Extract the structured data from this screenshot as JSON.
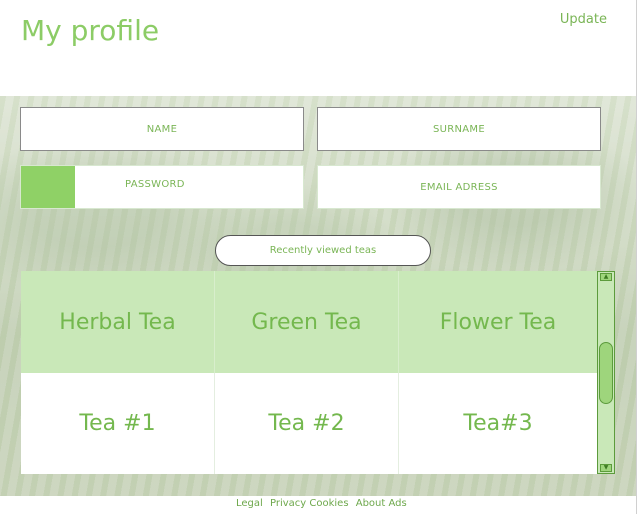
{
  "header": {
    "title": "My profile",
    "update_label": "Update"
  },
  "form": {
    "name_label": "NAME",
    "surname_label": "SURNAME",
    "password_label": "PASSWORD",
    "password_strength": 0.19,
    "email_label": "EMAIL ADRESS"
  },
  "recent_button": "Recently viewed teas",
  "teas": {
    "categories": [
      "Herbal Tea",
      "Green Tea",
      "Flower Tea"
    ],
    "items": [
      "Tea #1",
      "Tea #2",
      "Tea#3"
    ]
  },
  "footer": {
    "links": [
      "Legal",
      "Privacy Cookies",
      "About Ads"
    ]
  },
  "colors": {
    "accent": "#8ccc66",
    "header_row": "#c9e8b8",
    "text_green": "#74b84e"
  }
}
